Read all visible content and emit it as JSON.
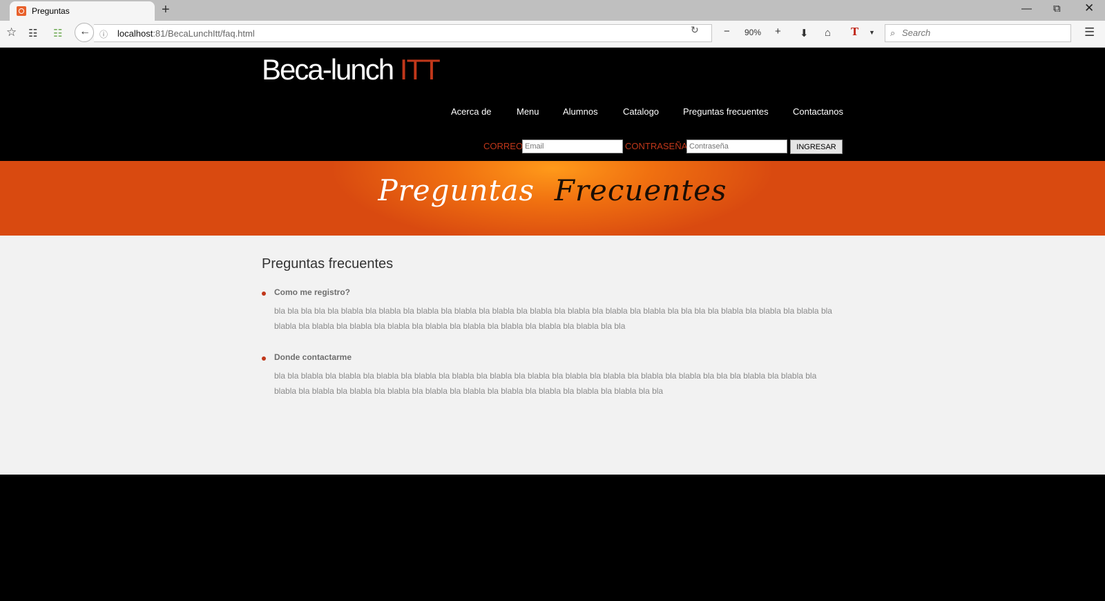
{
  "browser": {
    "tab_title": "Preguntas",
    "new_tab": "+",
    "url_host": "localhost",
    "url_rest": ":81/BecaLunchItt/faq.html",
    "zoom_out": "−",
    "zoom_level": "90%",
    "zoom_in": "+",
    "search_placeholder": "Search"
  },
  "site": {
    "logo_main": "Beca-lunch ",
    "logo_accent": "ITT",
    "accent_color": "#c0371a",
    "nav": [
      "Acerca de",
      "Menu",
      "Alumnos",
      "Catalogo",
      "Preguntas frecuentes",
      "Contactanos"
    ],
    "login": {
      "email_label": "CORREO",
      "email_placeholder": "Email",
      "password_label": "CONTRASEÑA",
      "password_placeholder": "Contraseña",
      "submit_label": "INGRESAR"
    },
    "banner": {
      "word1": "Preguntas",
      "word2": "Frecuentes"
    }
  },
  "faq": {
    "heading": "Preguntas frecuentes",
    "items": [
      {
        "question": "Como me registro?",
        "answer": "bla bla bla bla bla blabla bla blabla bla blabla bla blabla bla blabla bla blabla bla blabla bla blabla bla blabla bla bla bla bla blabla bla blabla bla blabla bla blabla bla blabla bla blabla bla blabla bla blabla bla blabla bla blabla bla blabla bla blabla bla bla"
      },
      {
        "question": "Donde contactarme",
        "answer": "bla bla blabla bla blabla bla blabla bla blabla bla blabla bla blabla bla blabla bla blabla bla blabla bla blabla bla blabla bla bla bla blabla bla blabla bla blabla bla blabla bla blabla bla blabla bla blabla bla blabla bla blabla bla blabla bla blabla bla blabla bla bla"
      }
    ]
  }
}
